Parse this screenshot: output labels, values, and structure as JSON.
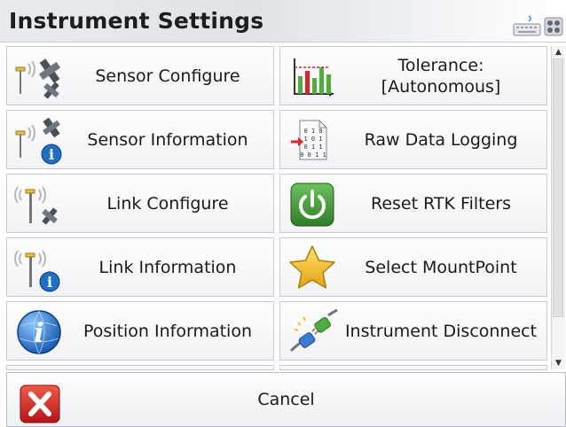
{
  "window": {
    "title": "Instrument Settings"
  },
  "toolbar": {
    "keyboard_icon": "keyboard-icon",
    "equalizer_icon": "equalizer-icon"
  },
  "menu": {
    "left": [
      {
        "label": "Sensor Configure",
        "icon": "sensor-configure-icon"
      },
      {
        "label": "Sensor Information",
        "icon": "sensor-information-icon"
      },
      {
        "label": "Link Configure",
        "icon": "link-configure-icon"
      },
      {
        "label": "Link Information",
        "icon": "link-information-icon"
      },
      {
        "label": "Position Information",
        "icon": "globe-info-icon"
      }
    ],
    "right": [
      {
        "label": "Tolerance:\n[Autonomous]",
        "icon": "tolerance-chart-icon"
      },
      {
        "label": "Raw Data Logging",
        "icon": "raw-data-file-icon"
      },
      {
        "label": "Reset RTK Filters",
        "icon": "power-icon"
      },
      {
        "label": "Select MountPoint",
        "icon": "star-icon"
      },
      {
        "label": "Instrument Disconnect",
        "icon": "plug-disconnect-icon"
      }
    ]
  },
  "footer": {
    "cancel_label": "Cancel",
    "cancel_icon": "close-icon"
  },
  "colors": {
    "accent_red": "#d8262a",
    "power_green": "#3c9a34",
    "star_gold": "#f4c21c",
    "info_blue": "#1e6fc4"
  }
}
